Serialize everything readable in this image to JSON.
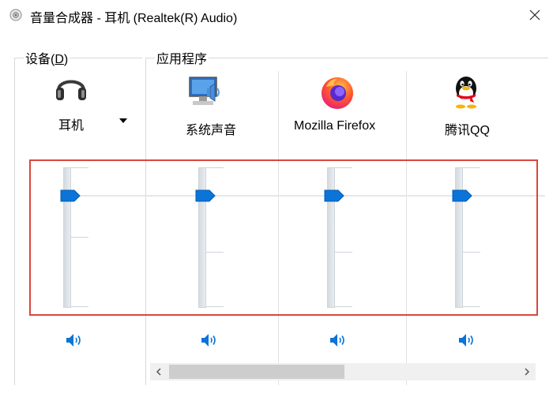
{
  "window": {
    "title": "音量合成器 - 耳机 (Realtek(R) Audio)",
    "close_glyph": "✕"
  },
  "groups": {
    "device": {
      "label_prefix": "设备(",
      "label_accel": "D",
      "label_suffix": ")"
    },
    "apps": {
      "label": "应用程序"
    }
  },
  "channels": [
    {
      "id": "device",
      "label": "耳机",
      "icon": "headphones-icon",
      "level_percent": 100,
      "muted": false,
      "has_dropdown": true
    },
    {
      "id": "system-sounds",
      "label": "系统声音",
      "icon": "system-sounds-icon",
      "level_percent": 100,
      "muted": false
    },
    {
      "id": "firefox",
      "label": "Mozilla Firefox",
      "icon": "firefox-icon",
      "level_percent": 100,
      "muted": false
    },
    {
      "id": "qq",
      "label": "腾讯QQ",
      "icon": "qq-penguin-icon",
      "level_percent": 100,
      "muted": false
    }
  ],
  "colors": {
    "accent": "#0a74d8",
    "highlight": "#d9463f",
    "track": "#e3e8ee"
  },
  "scrollbar": {
    "left_glyph": "‹",
    "right_glyph": "›"
  }
}
